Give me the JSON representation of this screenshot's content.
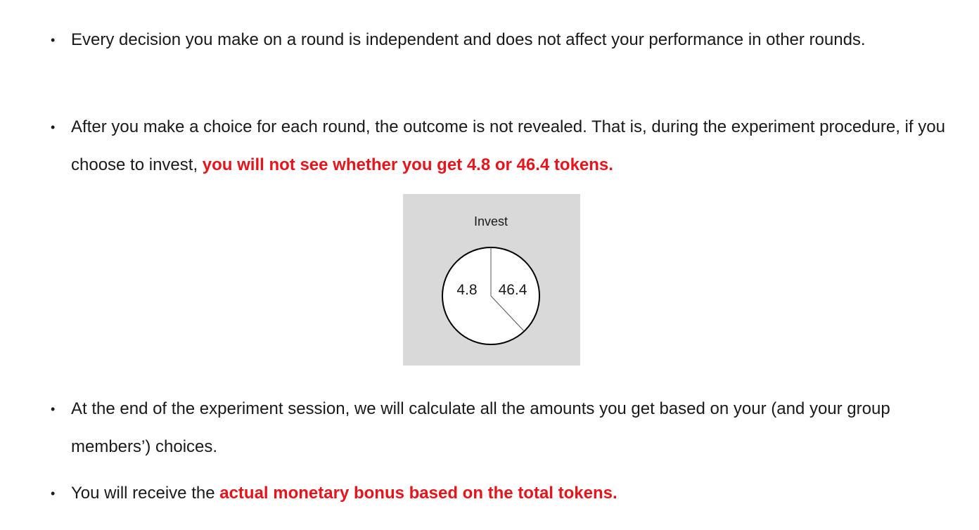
{
  "bullets": [
    {
      "text": "Every decision you make on a round is independent and does not affect your performance in other rounds.",
      "emphasis": ""
    },
    {
      "text": "After you make a choice for each round, the outcome is not revealed. That is, during the experiment procedure, if you choose to invest, ",
      "emphasis": "you will not see whether you get 4.8 or 46.4 tokens."
    },
    {
      "text": "At the end of the experiment session, we will calculate all the amounts you get based on your (and your group members’) choices.",
      "emphasis": ""
    },
    {
      "text": "You will receive the ",
      "emphasis": "actual monetary bonus based on the total tokens."
    }
  ],
  "bullet_glyph": "•",
  "figure": {
    "title": "Invest",
    "left_value": "4.8",
    "right_value": "46.4"
  },
  "colors": {
    "emphasis": "#e8141b",
    "figure_background": "#d9d9d9",
    "text": "#1a1a1a"
  }
}
